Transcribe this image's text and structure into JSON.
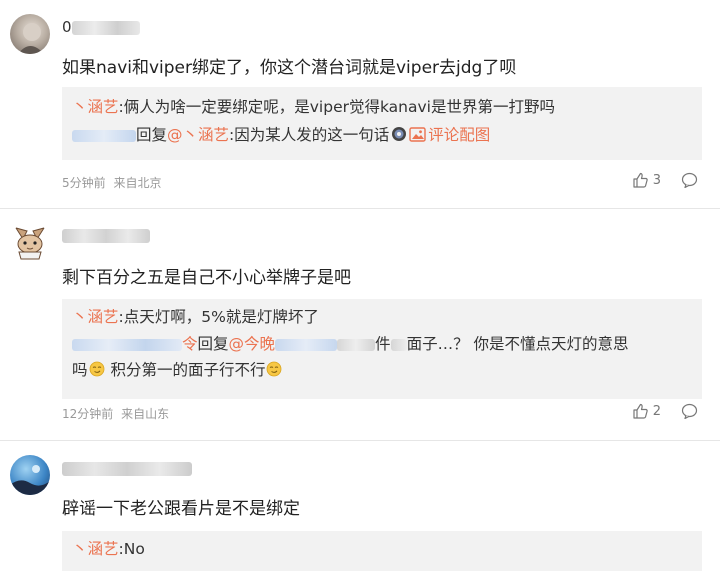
{
  "comments": [
    {
      "username_visible": "0",
      "text": "如果navi和viper绑定了，你这个潜台词就是viper去jdg了呗",
      "replies": [
        {
          "name": "丶涵艺",
          "sep": ":",
          "text": "俩人为啥一定要绑定呢，是viper觉得kanavi是世界第一打野吗"
        },
        {
          "action": "回复",
          "mention": "@丶涵艺",
          "sep": ":",
          "text": "因为某人发的这一句话",
          "image_link": "评论配图"
        }
      ],
      "time": "5分钟前",
      "location": "来自北京",
      "likes": "3"
    },
    {
      "username_visible": "",
      "text": "剩下百分之五是自己不小心举牌子是吧",
      "replies": [
        {
          "name": "丶涵艺",
          "sep": ":",
          "text": "点天灯啊，5%就是灯牌坏了"
        },
        {
          "name_tail": "令",
          "action": "回复",
          "mention": "@今晚",
          "tail_char": "件",
          "text": "面子…？ 你是不懂点天灯的意思"
        },
        {
          "text_a": "吗",
          "text_b": " 积分第一的面子行不行"
        }
      ],
      "time": "12分钟前",
      "location": "来自山东",
      "likes": "2"
    },
    {
      "username_visible": "",
      "text": "辟谣一下老公跟看片是不是绑定",
      "replies": [
        {
          "name": "丶涵艺",
          "sep": ":",
          "text": "No"
        }
      ]
    }
  ],
  "icons": {
    "like": "thumbs-up-icon",
    "comment": "comment-bubble-icon",
    "image": "image-icon",
    "emoji": "smirk-emoji-icon"
  },
  "colors": {
    "link": "#eb7350",
    "reply_bg": "#f2f2f2",
    "meta": "#999999"
  }
}
